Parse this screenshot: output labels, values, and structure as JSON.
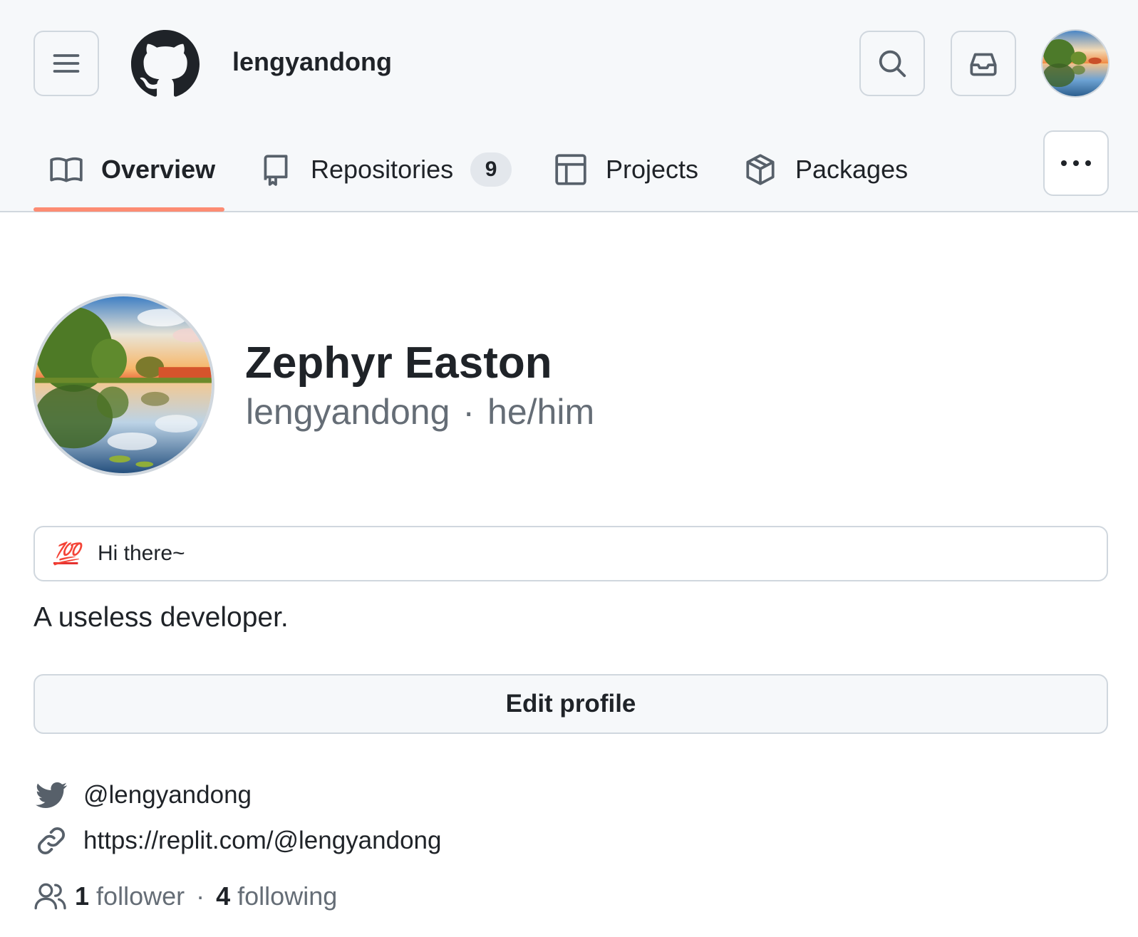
{
  "header": {
    "menu_icon": "three-bars-icon",
    "logo_icon": "github-mark-icon",
    "username": "lengyandong",
    "search_icon": "search-icon",
    "inbox_icon": "inbox-icon",
    "avatar_alt": "user avatar"
  },
  "tabs": [
    {
      "label": "Overview",
      "icon": "book-icon",
      "selected": true
    },
    {
      "label": "Repositories",
      "icon": "repo-icon",
      "count": "9"
    },
    {
      "label": "Projects",
      "icon": "table-icon"
    },
    {
      "label": "Packages",
      "icon": "package-icon"
    }
  ],
  "more_icon": "kebab-horizontal-icon",
  "profile": {
    "full_name": "Zephyr Easton",
    "login": "lengyandong",
    "separator": "·",
    "pronouns": "he/him",
    "status_emoji": "💯",
    "status_text": "Hi there~",
    "bio": "A useless developer.",
    "edit_label": "Edit profile",
    "twitter": "@lengyandong",
    "website": "https://replit.com/@lengyandong",
    "followers_count": "1",
    "followers_label": "follower",
    "following_count": "4",
    "following_label": "following"
  },
  "colors": {
    "tab_underline": "#fd8c73",
    "header_bg": "#f6f8fa",
    "border": "#d0d7de",
    "muted_text": "#656d76"
  }
}
